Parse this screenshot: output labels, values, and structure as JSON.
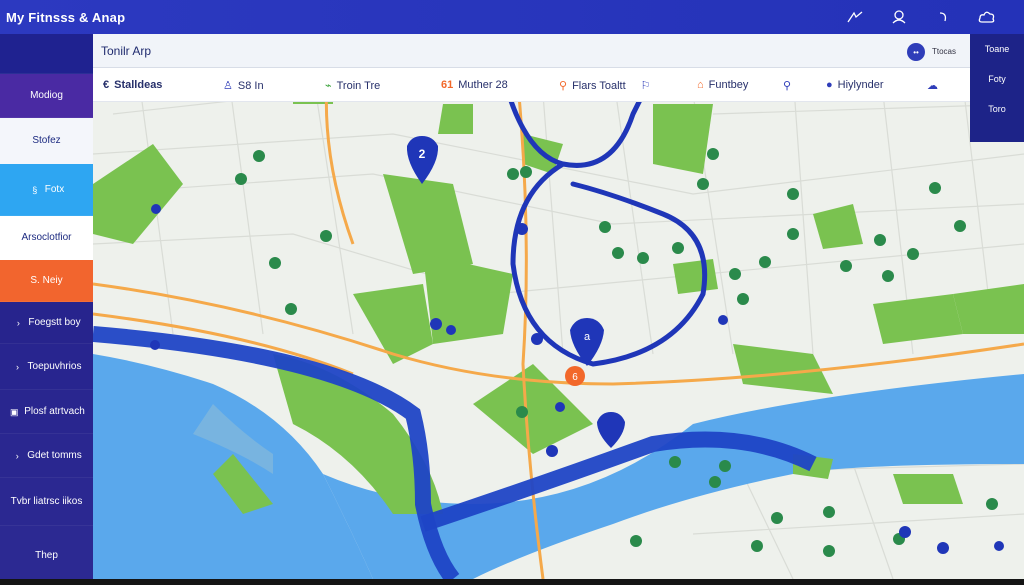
{
  "app": {
    "title": "My Fitnsss & Anap"
  },
  "topbar": {
    "icons": [
      "share-icon",
      "person-icon",
      "refresh-icon",
      "cloud-icon"
    ]
  },
  "header": {
    "title": "Tonilr Arp",
    "avatar_text": "••",
    "mode_label": "Ttocas"
  },
  "filters": [
    {
      "icon": "back-arrow-icon",
      "label": "Stalldeas",
      "bold": true
    },
    {
      "icon": "person-icon",
      "label": "S8 In"
    },
    {
      "icon": "route-icon",
      "label": "Troin Tre"
    },
    {
      "icon": "pin-icon",
      "label": "Muther 28",
      "prefix": "61"
    },
    {
      "icon": "location-icon",
      "label": "Flars Toaltt"
    },
    {
      "icon": "marker-icon",
      "label": "Funtbey"
    },
    {
      "icon": "search-icon",
      "label": ""
    },
    {
      "icon": "map-pin-icon",
      "label": "Hiylynder"
    },
    {
      "icon": "cloud-icon",
      "label": ""
    }
  ],
  "sidebar": {
    "items": [
      {
        "label": ""
      },
      {
        "label": "Modiog"
      },
      {
        "label": "Stofez"
      },
      {
        "label": "Fotx",
        "icon": "§"
      },
      {
        "label": "Arsoclotfior"
      },
      {
        "label": "S. Neiy"
      },
      {
        "label": "Foegstt boy",
        "icon": "›"
      },
      {
        "label": "Toepuvhrios",
        "icon": "›"
      },
      {
        "label": "Plosf atrtvach",
        "icon": "▣"
      },
      {
        "label": "Gdet tomms",
        "icon": "›"
      },
      {
        "label": "Tvbr liatrsc iikos"
      },
      {
        "label": "Thep"
      }
    ]
  },
  "right_menu": {
    "items": [
      "Toane",
      "Foty",
      "Toro"
    ]
  },
  "map": {
    "pin_labels": [
      "2",
      "a",
      "6"
    ],
    "colors": {
      "water": "#5aa8ec",
      "park": "#7ac250",
      "route": "#1f36b8",
      "road": "#f5a94a",
      "accent": "#f2682a"
    }
  }
}
